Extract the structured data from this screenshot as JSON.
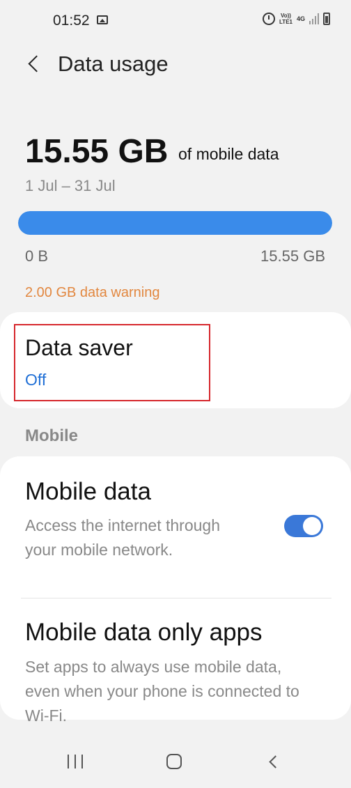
{
  "status": {
    "time": "01:52",
    "volte_line1": "Vo))",
    "volte_line2": "LTE1",
    "network": "4G"
  },
  "header": {
    "title": "Data usage"
  },
  "usage": {
    "amount": "15.55 GB",
    "of_label": "of mobile data",
    "period": "1 Jul – 31 Jul",
    "bar_min": "0 B",
    "bar_max": "15.55 GB",
    "fill_fraction": 1.0,
    "warning": "2.00 GB data warning"
  },
  "data_saver": {
    "title": "Data saver",
    "value": "Off"
  },
  "mobile_section": {
    "header": "Mobile",
    "mobile_data": {
      "title": "Mobile data",
      "description": "Access the internet through your mobile network.",
      "enabled": true
    },
    "mobile_data_only_apps": {
      "title": "Mobile data only apps",
      "description": "Set apps to always use mobile data, even when your phone is connected to Wi-Fi."
    }
  },
  "colors": {
    "accent": "#3a8bea",
    "warning": "#e2873f",
    "highlight": "#d6262c",
    "link": "#2170d6"
  },
  "icons": {
    "status": [
      "image-icon",
      "alarm-icon",
      "signal-icon",
      "battery-icon"
    ],
    "nav": [
      "recents-icon",
      "home-icon",
      "back-icon"
    ]
  }
}
